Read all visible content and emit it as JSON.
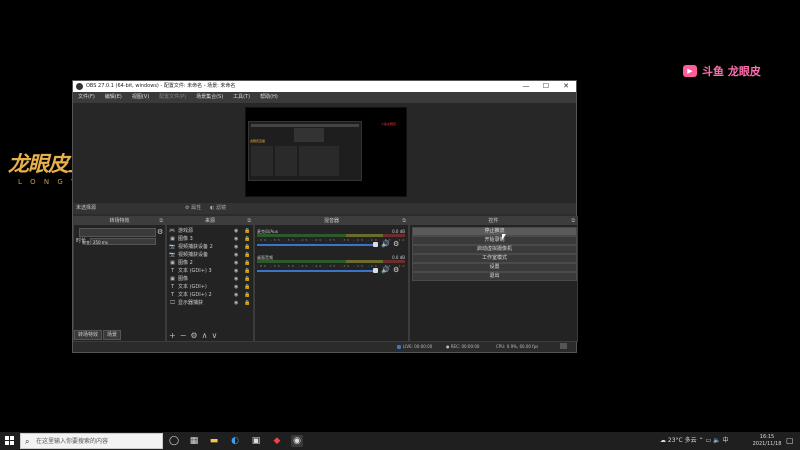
{
  "watermark_left": {
    "main": "龙眼皮直播",
    "sub": "L O N G Y A N P I"
  },
  "watermark_right": {
    "brand": "斗鱼 龙眼皮"
  },
  "obs": {
    "title": "OBS 27.0.1 (64-bit, windows) - 配置文件: 未命名 - 场景: 未命名",
    "window_controls": [
      "—",
      "☐",
      "✕"
    ],
    "menu": [
      "文件(F)",
      "编辑(E)",
      "视图(V)",
      "配置文件(P)",
      "场景集合(S)",
      "工具(T)",
      "帮助(H)"
    ],
    "scene_label": "未选择源",
    "properties_btn": "属性",
    "filters_btn": "滤镜",
    "docks": {
      "transitions": {
        "title": "转场特效",
        "current": "渐变",
        "duration_label": "时长",
        "duration_value": "250 ms",
        "tabs": [
          "转场特效",
          "场景"
        ]
      },
      "sources": {
        "title": "来源",
        "items": [
          {
            "icon": "game-icon",
            "glyph": "🎮",
            "label": "游戏源"
          },
          {
            "icon": "image-icon",
            "glyph": "▣",
            "label": "图像 3"
          },
          {
            "icon": "camera-icon",
            "glyph": "📷",
            "label": "视频捕获设备 2"
          },
          {
            "icon": "camera-icon",
            "glyph": "📷",
            "label": "视频捕获设备"
          },
          {
            "icon": "image-icon",
            "glyph": "▣",
            "label": "图像 2"
          },
          {
            "icon": "text-icon",
            "glyph": "T",
            "label": "文本 (GDI+) 3"
          },
          {
            "icon": "image-icon",
            "glyph": "▣",
            "label": "图像"
          },
          {
            "icon": "text-icon",
            "glyph": "T",
            "label": "文本 (GDI+)"
          },
          {
            "icon": "text-icon",
            "glyph": "T",
            "label": "文本 (GDI+) 2"
          },
          {
            "icon": "monitor-icon",
            "glyph": "🖵",
            "label": "显示器捕获"
          }
        ]
      },
      "mixer": {
        "title": "混音器",
        "channels": [
          {
            "name": "麦克风/Aux",
            "db": "0.0 dB"
          },
          {
            "name": "桌面音频",
            "db": "0.0 dB"
          }
        ],
        "ticks": "-60 -55 -50 -45 -40 -35 -30 -25 -20 -15 -10 -5 0"
      },
      "controls": {
        "title": "控件",
        "buttons": [
          "停止推流",
          "开始录制",
          "启动虚拟摄像机",
          "工作室模式",
          "设置",
          "退出"
        ]
      }
    },
    "status": {
      "live": "LIVE: 00:00:00",
      "rec": "REC: 00:00:00",
      "cpu": "CPU: 0.9%, 60.00 fps"
    }
  },
  "taskbar": {
    "search_placeholder": "在这里输入你要搜索的内容",
    "weather": "23°C 多云",
    "time": "16:15",
    "date": "2021/11/18",
    "ime": "中"
  }
}
